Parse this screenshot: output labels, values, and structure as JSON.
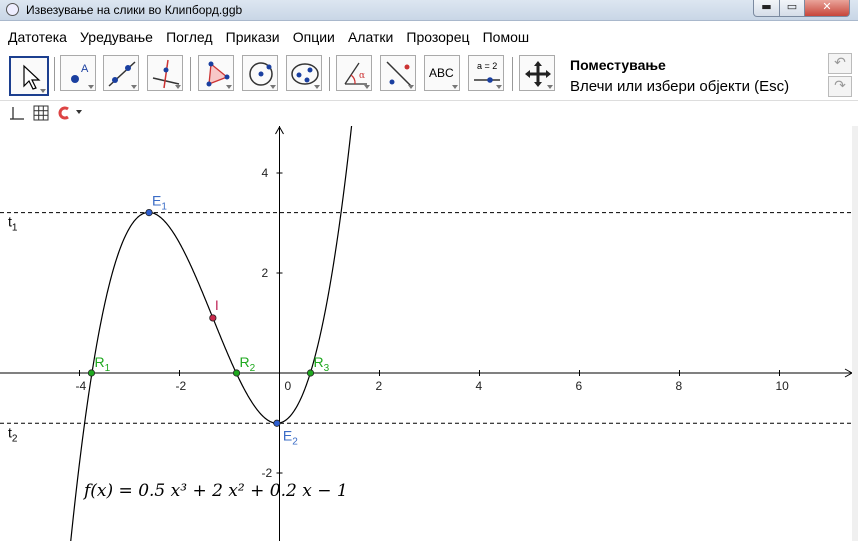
{
  "window": {
    "title": "Извезување на слики во Клипборд.ggb",
    "min": "▬",
    "max": "▭",
    "close": "✕"
  },
  "menu": [
    "Датотека",
    "Уредување",
    "Поглед",
    "Прикази",
    "Опции",
    "Алатки",
    "Прозорец",
    "Помош"
  ],
  "toolbar": {
    "tool_name": "Поместување",
    "tool_help": "Влечи или избери објекти (Esc)",
    "text_tool": "ABC",
    "slider_tool": "a = 2",
    "undo": "↶",
    "redo": "↷"
  },
  "graph": {
    "function_label": "f(x)  =  0.5 x³ + 2 x² + 0.2 x − 1",
    "x_ticks": [
      "-4",
      "-2",
      "0",
      "2",
      "4",
      "6",
      "8",
      "10"
    ],
    "y_ticks": [
      "4",
      "2",
      "-2"
    ],
    "points": {
      "E1": {
        "label": "E",
        "sub": "1",
        "x": -2.609,
        "y": 3.208
      },
      "E2": {
        "label": "E",
        "sub": "2",
        "x": -0.052,
        "y": -1.005
      },
      "I": {
        "label": "I",
        "x": -1.333,
        "y": 1.101
      },
      "R1": {
        "label": "R",
        "sub": "1",
        "x": -3.761,
        "y": 0
      },
      "R2": {
        "label": "R",
        "sub": "2",
        "x": -0.859,
        "y": 0
      },
      "R3": {
        "label": "R",
        "sub": "3",
        "x": 0.62,
        "y": 0
      }
    },
    "lines": {
      "t1": {
        "label": "t",
        "sub": "1",
        "y": 3.208
      },
      "t2": {
        "label": "t",
        "sub": "2",
        "y": -1.005
      }
    },
    "colors": {
      "extrema": "#2e5fd1",
      "roots": "#1fa81f",
      "inflection": "#c8284a",
      "label_e": "#3b6cc6",
      "label_r": "#1fa81f",
      "label_i": "#c0285a"
    }
  }
}
